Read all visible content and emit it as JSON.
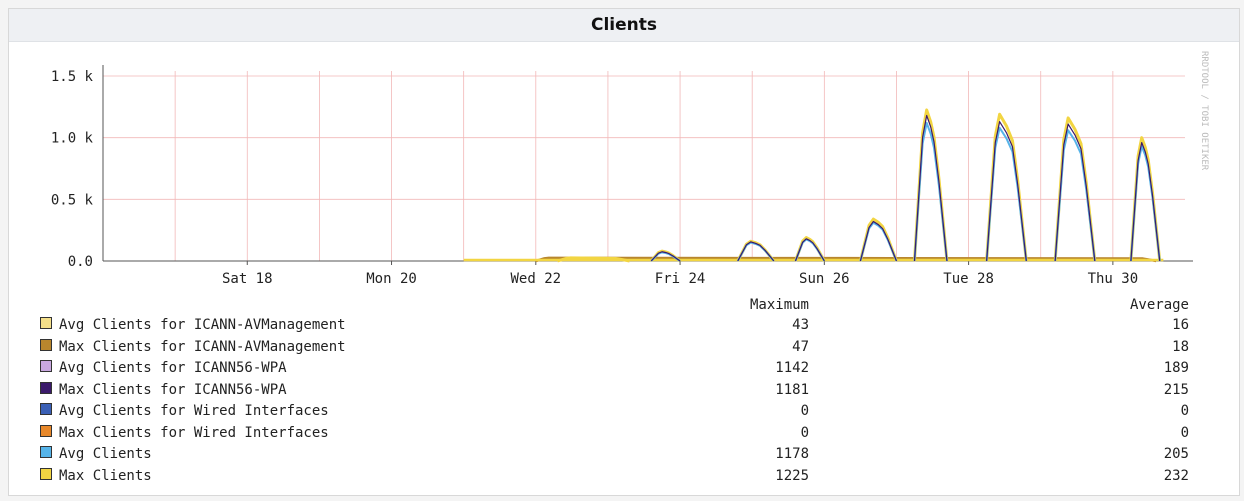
{
  "title": "Clients",
  "watermark": "RRDTOOL / TOBI OETIKER",
  "chart_data": {
    "type": "line",
    "title": "Clients",
    "x_range": [
      "2016-03-16",
      "2016-03-31"
    ],
    "x_ticks": [
      {
        "label": "Sat 18",
        "day": 2
      },
      {
        "label": "Mon 20",
        "day": 4
      },
      {
        "label": "Wed 22",
        "day": 6
      },
      {
        "label": "Fri 24",
        "day": 8
      },
      {
        "label": "Sun 26",
        "day": 10
      },
      {
        "label": "Tue 28",
        "day": 12
      },
      {
        "label": "Thu 30",
        "day": 14
      }
    ],
    "y_ticks": [
      {
        "label": "0.0",
        "value": 0
      },
      {
        "label": "0.5 k",
        "value": 500
      },
      {
        "label": "1.0 k",
        "value": 1000
      },
      {
        "label": "1.5 k",
        "value": 1500
      }
    ],
    "ylim": [
      0,
      1500
    ],
    "grid": true,
    "series": [
      {
        "name": "Max Clients",
        "color": "#f2d542",
        "width": 3,
        "points": [
          [
            5,
            0
          ],
          [
            14.7,
            0
          ]
        ],
        "peaks": [
          [
            6.3,
            7.3,
            25
          ],
          [
            7.6,
            8.0,
            80
          ],
          [
            8.8,
            9.3,
            160
          ],
          [
            9.6,
            10.0,
            190
          ],
          [
            10.5,
            11.0,
            340
          ],
          [
            11.25,
            11.7,
            1225
          ],
          [
            12.25,
            12.8,
            1190
          ],
          [
            13.2,
            13.75,
            1160
          ],
          [
            14.25,
            14.65,
            1000
          ]
        ]
      },
      {
        "name": "Avg Clients",
        "color": "#56b4e9",
        "width": 2,
        "peaks": [
          [
            7.6,
            8.0,
            70
          ],
          [
            8.8,
            9.3,
            150
          ],
          [
            9.6,
            10.0,
            175
          ],
          [
            10.5,
            11.0,
            310
          ],
          [
            11.25,
            11.7,
            1120
          ],
          [
            12.25,
            12.8,
            1080
          ],
          [
            13.2,
            13.75,
            1060
          ],
          [
            14.25,
            14.65,
            930
          ]
        ]
      },
      {
        "name": "Max Clients for ICANN56-WPA",
        "color": "#3b1a6b",
        "width": 1.2,
        "peaks": [
          [
            7.6,
            8.0,
            75
          ],
          [
            8.8,
            9.3,
            155
          ],
          [
            9.6,
            10.0,
            180
          ],
          [
            10.5,
            11.0,
            320
          ],
          [
            11.25,
            11.7,
            1180
          ],
          [
            12.25,
            12.8,
            1130
          ],
          [
            13.2,
            13.75,
            1110
          ],
          [
            14.25,
            14.65,
            960
          ]
        ]
      },
      {
        "name": "Max Clients for ICANN-AVManagement",
        "color": "#b8862d",
        "width": 2.5,
        "peaks": [
          [
            6.0,
            14.6,
            25
          ]
        ]
      }
    ]
  },
  "legend": {
    "max_header": "Maximum",
    "avg_header": "Average",
    "items": [
      {
        "label": "Avg Clients for ICANN-AVManagement",
        "color": "#f5e08a",
        "max": "43",
        "avg": "16"
      },
      {
        "label": "Max Clients for ICANN-AVManagement",
        "color": "#b8862d",
        "max": "47",
        "avg": "18"
      },
      {
        "label": "Avg Clients for ICANN56-WPA",
        "color": "#c9a8e0",
        "max": "1142",
        "avg": "189"
      },
      {
        "label": "Max Clients for ICANN56-WPA",
        "color": "#3b1a6b",
        "max": "1181",
        "avg": "215"
      },
      {
        "label": "Avg Clients for Wired Interfaces",
        "color": "#3a5fb5",
        "max": "0",
        "avg": "0"
      },
      {
        "label": "Max Clients for Wired Interfaces",
        "color": "#e8882a",
        "max": "0",
        "avg": "0"
      },
      {
        "label": "Avg Clients",
        "color": "#56b4e9",
        "max": "1178",
        "avg": "205"
      },
      {
        "label": "Max Clients",
        "color": "#f2d542",
        "max": "1225",
        "avg": "232"
      }
    ]
  }
}
